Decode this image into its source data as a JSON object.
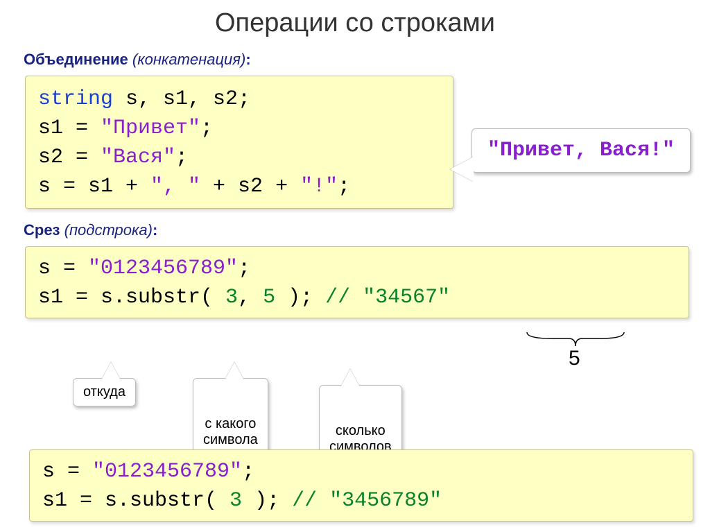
{
  "title": "Операции со строками",
  "section1": {
    "heading_bold": "Объединение",
    "heading_italic": "(конкатенация)",
    "heading_colon": ":",
    "code": {
      "line1_kw": "string",
      "line1_rest": " s, s1, s2;",
      "line2_pre": "s1 = ",
      "line2_str": "\"Привет\"",
      "line2_post": ";",
      "line3_pre": "s2 = ",
      "line3_str": "\"Вася\"",
      "line3_post": ";",
      "line4_a": "s = s1 + ",
      "line4_s1": "\", \"",
      "line4_b": " + s2 + ",
      "line4_s2": "\"!\"",
      "line4_c": ";"
    }
  },
  "callout_result": "\"Привет, Вася!\"",
  "section2": {
    "heading_bold": "Срез",
    "heading_italic": "(подстрока)",
    "heading_colon": ":",
    "code": {
      "l1_pre": "s = ",
      "l1_str": "\"0123456789\"",
      "l1_post": ";",
      "l2_pre": "s1 = s.substr( ",
      "l2_n1": "3",
      "l2_mid": ", ",
      "l2_n2": "5",
      "l2_post": " );    ",
      "l2_cmt": "// \"34567\""
    }
  },
  "annot": {
    "from": "откуда",
    "which": "с какого\nсимвола",
    "howmany": "сколько\nсимволов",
    "five": "5"
  },
  "section3": {
    "code": {
      "l1_pre": "s = ",
      "l1_str": "\"0123456789\"",
      "l1_post": ";",
      "l2_pre": "s1 = s.substr( ",
      "l2_n1": "3",
      "l2_post": " );    ",
      "l2_cmt": "// \"3456789\""
    }
  }
}
